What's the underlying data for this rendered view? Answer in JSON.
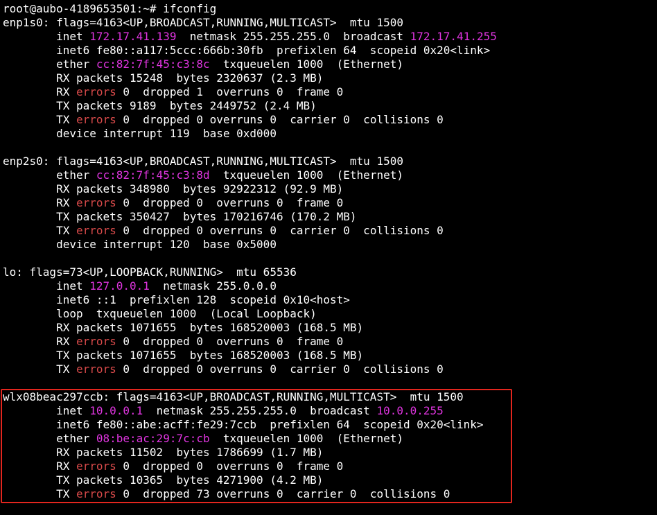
{
  "terminal": {
    "prompt": "root@aubo-4189653501:~# ",
    "command": "ifconfig",
    "interfaces": [
      {
        "header": "enp1s0: flags=4163<UP,BROADCAST,RUNNING,MULTICAST>  mtu 1500",
        "lines": [
          [
            {
              "t": "        inet "
            },
            {
              "t": "172.17.41.139",
              "c": "hl"
            },
            {
              "t": "  netmask 255.255.255.0  broadcast "
            },
            {
              "t": "172.17.41.255",
              "c": "hl"
            }
          ],
          [
            {
              "t": "        inet6 fe80::a117:5ccc:666b:30fb  prefixlen 64  scopeid 0x20<link>"
            }
          ],
          [
            {
              "t": "        ether "
            },
            {
              "t": "cc:82:7f:45:c3:8c",
              "c": "hl"
            },
            {
              "t": "  txqueuelen 1000  (Ethernet)"
            }
          ],
          [
            {
              "t": "        RX packets 15248  bytes 2320637 (2.3 MB)"
            }
          ],
          [
            {
              "t": "        RX "
            },
            {
              "t": "errors",
              "c": "err"
            },
            {
              "t": " 0  dropped 1  overruns 0  frame 0"
            }
          ],
          [
            {
              "t": "        TX packets 9189  bytes 2449752 (2.4 MB)"
            }
          ],
          [
            {
              "t": "        TX "
            },
            {
              "t": "errors",
              "c": "err"
            },
            {
              "t": " 0  dropped 0 overruns 0  carrier 0  collisions 0"
            }
          ],
          [
            {
              "t": "        device interrupt 119  base 0xd000"
            }
          ]
        ]
      },
      {
        "header": "enp2s0: flags=4163<UP,BROADCAST,RUNNING,MULTICAST>  mtu 1500",
        "lines": [
          [
            {
              "t": "        ether "
            },
            {
              "t": "cc:82:7f:45:c3:8d",
              "c": "hl"
            },
            {
              "t": "  txqueuelen 1000  (Ethernet)"
            }
          ],
          [
            {
              "t": "        RX packets 348980  bytes 92922312 (92.9 MB)"
            }
          ],
          [
            {
              "t": "        RX "
            },
            {
              "t": "errors",
              "c": "err"
            },
            {
              "t": " 0  dropped 0  overruns 0  frame 0"
            }
          ],
          [
            {
              "t": "        TX packets 350427  bytes 170216746 (170.2 MB)"
            }
          ],
          [
            {
              "t": "        TX "
            },
            {
              "t": "errors",
              "c": "err"
            },
            {
              "t": " 0  dropped 0 overruns 0  carrier 0  collisions 0"
            }
          ],
          [
            {
              "t": "        device interrupt 120  base 0x5000"
            }
          ]
        ]
      },
      {
        "header": "lo: flags=73<UP,LOOPBACK,RUNNING>  mtu 65536",
        "lines": [
          [
            {
              "t": "        inet "
            },
            {
              "t": "127.0.0.1",
              "c": "hl"
            },
            {
              "t": "  netmask 255.0.0.0"
            }
          ],
          [
            {
              "t": "        inet6 ::1  prefixlen 128  scopeid 0x10<host>"
            }
          ],
          [
            {
              "t": "        loop  txqueuelen 1000  (Local Loopback)"
            }
          ],
          [
            {
              "t": "        RX packets 1071655  bytes 168520003 (168.5 MB)"
            }
          ],
          [
            {
              "t": "        RX "
            },
            {
              "t": "errors",
              "c": "err"
            },
            {
              "t": " 0  dropped 0  overruns 0  frame 0"
            }
          ],
          [
            {
              "t": "        TX packets 1071655  bytes 168520003 (168.5 MB)"
            }
          ],
          [
            {
              "t": "        TX "
            },
            {
              "t": "errors",
              "c": "err"
            },
            {
              "t": " 0  dropped 0 overruns 0  carrier 0  collisions 0"
            }
          ]
        ]
      },
      {
        "header": "wlx08beac297ccb: flags=4163<UP,BROADCAST,RUNNING,MULTICAST>  mtu 1500",
        "lines": [
          [
            {
              "t": "        inet "
            },
            {
              "t": "10.0.0.1",
              "c": "hl"
            },
            {
              "t": "  netmask 255.255.255.0  broadcast "
            },
            {
              "t": "10.0.0.255",
              "c": "hl"
            }
          ],
          [
            {
              "t": "        inet6 fe80::abe:acff:fe29:7ccb  prefixlen 64  scopeid 0x20<link>"
            }
          ],
          [
            {
              "t": "        ether "
            },
            {
              "t": "08:be:ac:29:7c:cb",
              "c": "hl"
            },
            {
              "t": "  txqueuelen 1000  (Ethernet)"
            }
          ],
          [
            {
              "t": "        RX packets 11502  bytes 1786699 (1.7 MB)"
            }
          ],
          [
            {
              "t": "        RX "
            },
            {
              "t": "errors",
              "c": "err"
            },
            {
              "t": " 0  dropped 0  overruns 0  frame 0"
            }
          ],
          [
            {
              "t": "        TX packets 10365  bytes 4271900 (4.2 MB)"
            }
          ],
          [
            {
              "t": "        TX "
            },
            {
              "t": "errors",
              "c": "err"
            },
            {
              "t": " 0  dropped 73 overruns 0  carrier 0  collisions 0"
            }
          ]
        ]
      }
    ]
  },
  "colors": {
    "background": "#000000",
    "text": "#ffffff",
    "address_highlight": "#e135e1",
    "error_highlight": "#d84a4a",
    "annotation_box": "#e3261e"
  }
}
